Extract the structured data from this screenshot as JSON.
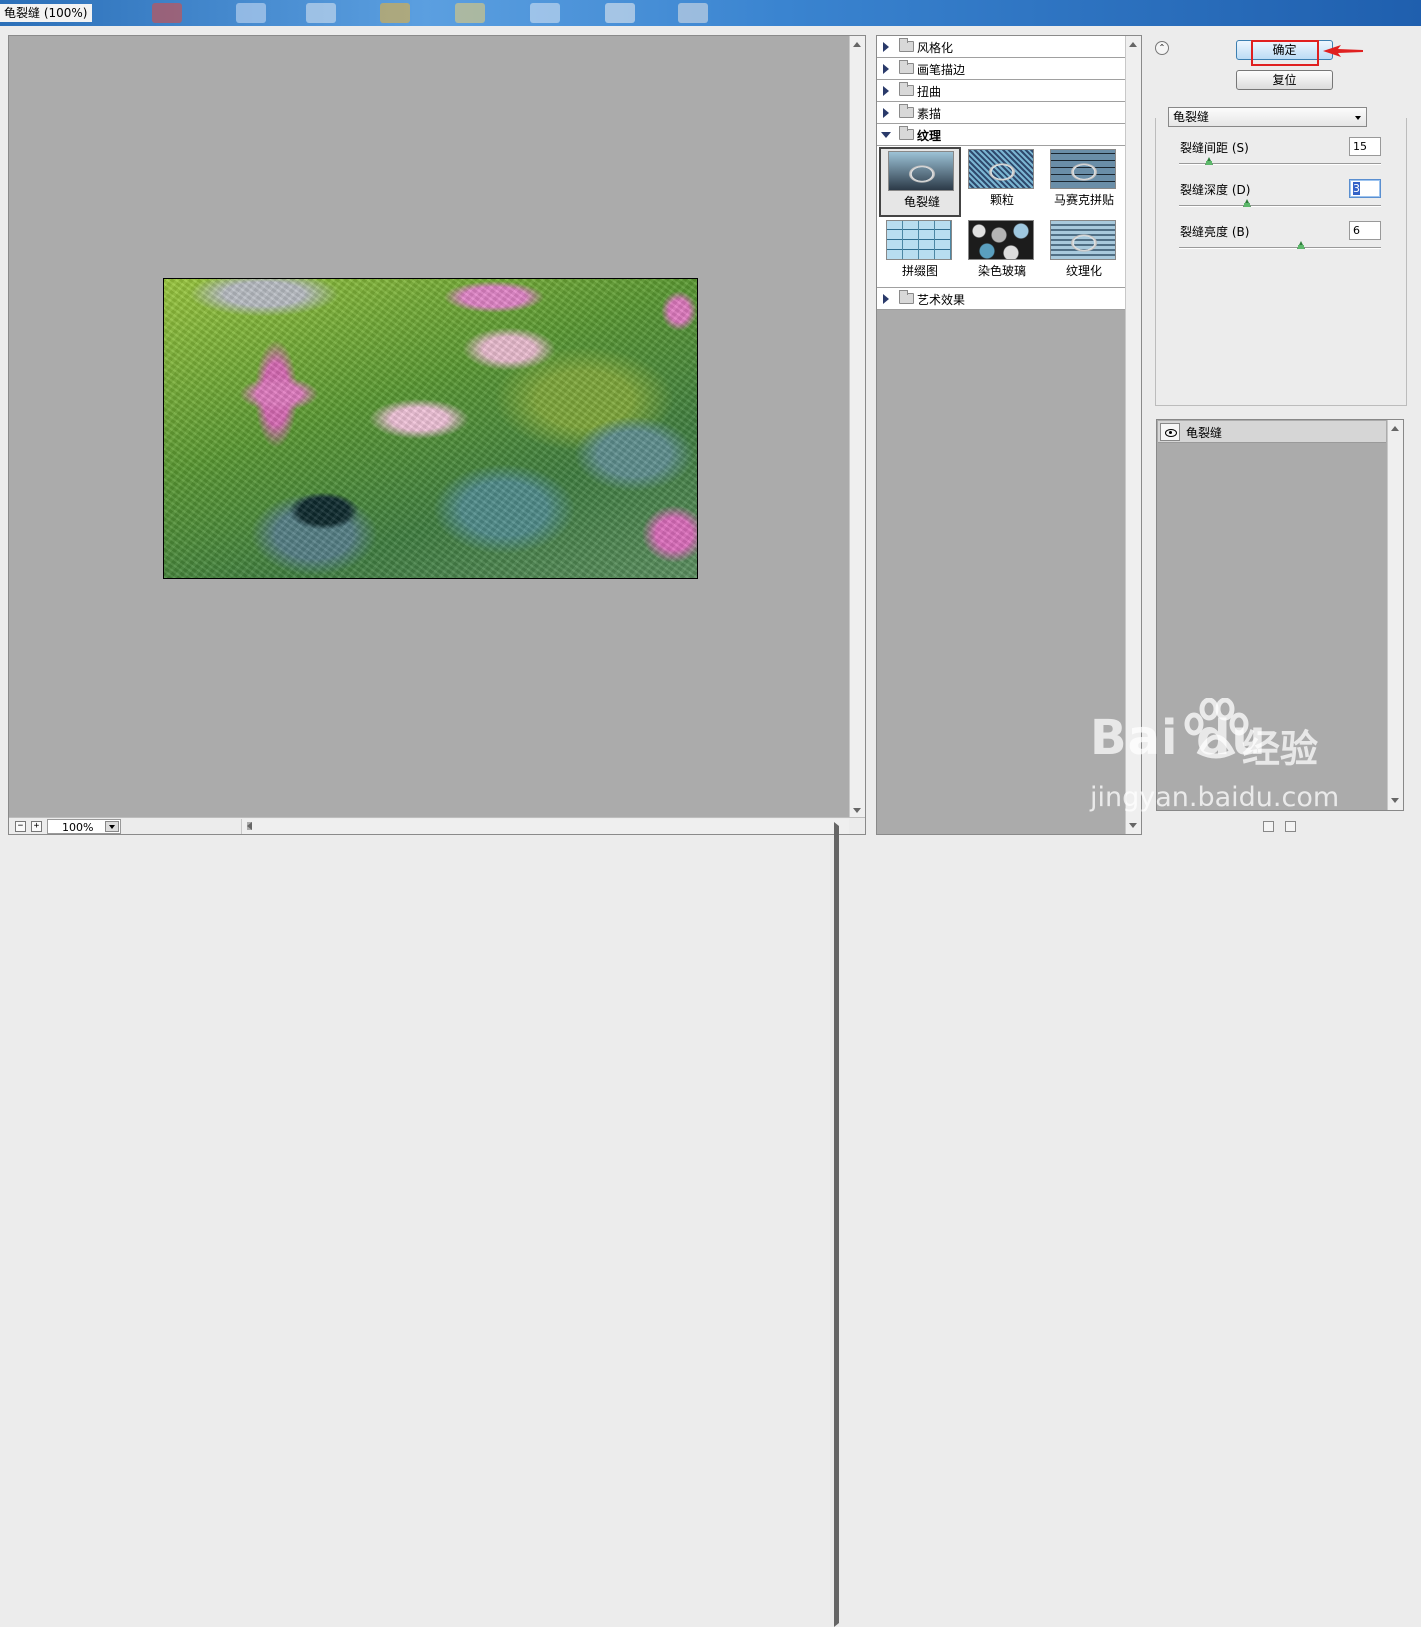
{
  "window": {
    "title": "龟裂缝 (100%)"
  },
  "preview": {
    "zoom": "100%",
    "zoom_out": "−",
    "zoom_in": "+"
  },
  "categories": [
    {
      "label": "风格化",
      "expanded": false
    },
    {
      "label": "画笔描边",
      "expanded": false
    },
    {
      "label": "扭曲",
      "expanded": false
    },
    {
      "label": "素描",
      "expanded": false
    },
    {
      "label": "纹理",
      "expanded": true
    },
    {
      "label": "艺术效果",
      "expanded": false
    }
  ],
  "filters": [
    {
      "label": "龟裂缝",
      "selected": true
    },
    {
      "label": "颗粒",
      "selected": false
    },
    {
      "label": "马赛克拼贴",
      "selected": false
    },
    {
      "label": "拼缀图",
      "selected": false
    },
    {
      "label": "染色玻璃",
      "selected": false
    },
    {
      "label": "纹理化",
      "selected": false
    }
  ],
  "buttons": {
    "ok": "确定",
    "reset": "复位",
    "collapse": "⌃"
  },
  "filter_select": {
    "value": "龟裂缝"
  },
  "params": [
    {
      "label": "裂缝间距 (S)",
      "value": "15",
      "level": 0.15
    },
    {
      "label": "裂缝深度 (D)",
      "value": "3",
      "level": 0.3
    },
    {
      "label": "裂缝亮度 (B)",
      "value": "6",
      "level": 0.6
    }
  ],
  "layers": [
    {
      "label": "龟裂缝",
      "visible": true
    }
  ],
  "watermark": {
    "brand": "Bai du",
    "cn": "经验",
    "url": "jingyan.baidu.com"
  },
  "colors": {
    "highlight": "#e02020",
    "accent": "#3c7fb1",
    "canvas_bg": "#ababab"
  }
}
